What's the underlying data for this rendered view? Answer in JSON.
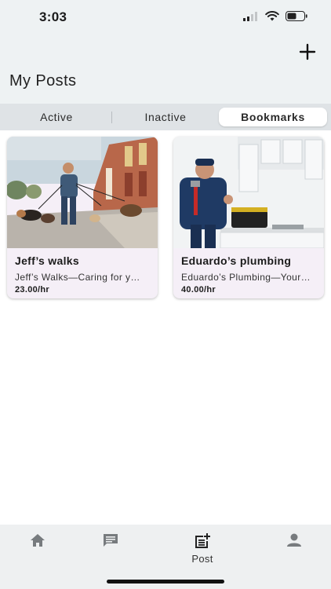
{
  "status_bar": {
    "time": "3:03"
  },
  "header": {
    "title": "My Posts",
    "add_icon": "plus-icon"
  },
  "tabs": [
    {
      "label": "Active",
      "selected": false
    },
    {
      "label": "Inactive",
      "selected": false
    },
    {
      "label": "Bookmarks",
      "selected": true
    }
  ],
  "posts": [
    {
      "title": "Jeff’s walks",
      "description": "Jeff’s Walks—Caring for y…",
      "price": "23.00/hr"
    },
    {
      "title": "Eduardo’s plumbing",
      "description": "Eduardo’s Plumbing—Your…",
      "price": "40.00/hr"
    }
  ],
  "bottom_nav": [
    {
      "icon": "home-icon",
      "label": ""
    },
    {
      "icon": "message-icon",
      "label": ""
    },
    {
      "icon": "post-add-icon",
      "label": "Post"
    },
    {
      "icon": "profile-icon",
      "label": ""
    }
  ],
  "colors": {
    "background": "#ffffff",
    "header_bg": "#eef2f3",
    "card_bg": "#f5eff7",
    "nav_icon": "#777b7e"
  }
}
